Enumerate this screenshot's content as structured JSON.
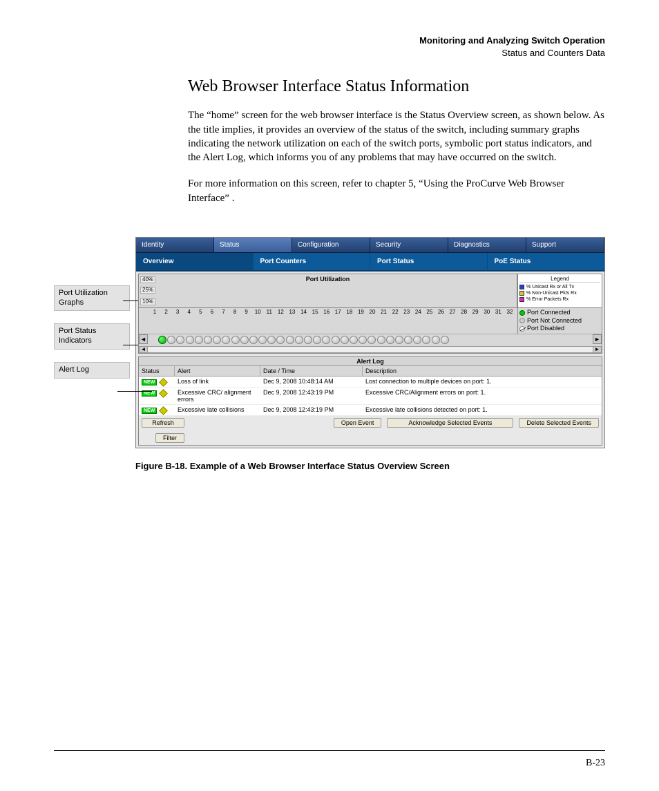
{
  "header": {
    "line1": "Monitoring and Analyzing Switch Operation",
    "line2": "Status and Counters Data"
  },
  "title": "Web Browser Interface Status Information",
  "para1": "The “home” screen for the web browser interface is the Status Overview screen, as shown below. As the title implies, it provides an overview of the status of the switch, including summary graphs indicating the network utilization on each of the switch ports, symbolic port status indicators, and the Alert Log, which informs you of any problems that may have occurred on the switch.",
  "para2": "For more information on this screen, refer to chapter 5, “Using the ProCurve Web Browser Interface” .",
  "callouts": {
    "c1": "Port Utilization Graphs",
    "c2": "Port Status Indicators",
    "c3": "Alert Log"
  },
  "screenshot": {
    "mainTabs": [
      "Identity",
      "Status",
      "Configuration",
      "Security",
      "Diagnostics",
      "Support"
    ],
    "activeMainTab": 1,
    "subTabs": [
      "Overview",
      "Port Counters",
      "Port Status",
      "PoE Status"
    ],
    "activeSubTab": 0,
    "portUtil": {
      "title": "Port Utilization",
      "yTicks": [
        "40%",
        "25%",
        "10%"
      ],
      "legendTitle": "Legend",
      "legend": [
        "% Unicast Rx or All Tx",
        "% Non-Unicast Pkts Rx",
        "% Error Packets Rx",
        "Port Connected",
        "Port Not Connected",
        "Port Disabled"
      ],
      "portNumbers": [
        "1",
        "2",
        "3",
        "4",
        "5",
        "6",
        "7",
        "8",
        "9",
        "10",
        "11",
        "12",
        "13",
        "14",
        "15",
        "16",
        "17",
        "18",
        "19",
        "20",
        "21",
        "22",
        "23",
        "24",
        "25",
        "26",
        "27",
        "28",
        "29",
        "30",
        "31",
        "32"
      ],
      "connectedPort": 1
    },
    "alertLog": {
      "title": "Alert Log",
      "columns": [
        "Status",
        "Alert",
        "Date / Time",
        "Description"
      ],
      "rows": [
        {
          "status": "NEW",
          "alert": "Loss of link",
          "date": "Dec 9, 2008 10:48:14 AM",
          "desc": "Lost connection to multiple devices on port: 1."
        },
        {
          "status": "NEW",
          "alert": "Excessive CRC/ alignment errors",
          "date": "Dec 9, 2008 12:43:19 PM",
          "desc": "Excessive CRC/Alignment errors on port: 1."
        },
        {
          "status": "NEW",
          "alert": "Excessive late collisions",
          "date": "Dec 9, 2008 12:43:19 PM",
          "desc": "Excessive late collisions detected on port: 1."
        }
      ],
      "buttons": {
        "refresh": "Refresh",
        "filter": "Filter",
        "open": "Open Event",
        "ack": "Acknowledge Selected Events",
        "del": "Delete Selected Events"
      }
    }
  },
  "caption": "Figure B-18.  Example of a Web Browser Interface Status Overview Screen",
  "pageNum": "B-23"
}
